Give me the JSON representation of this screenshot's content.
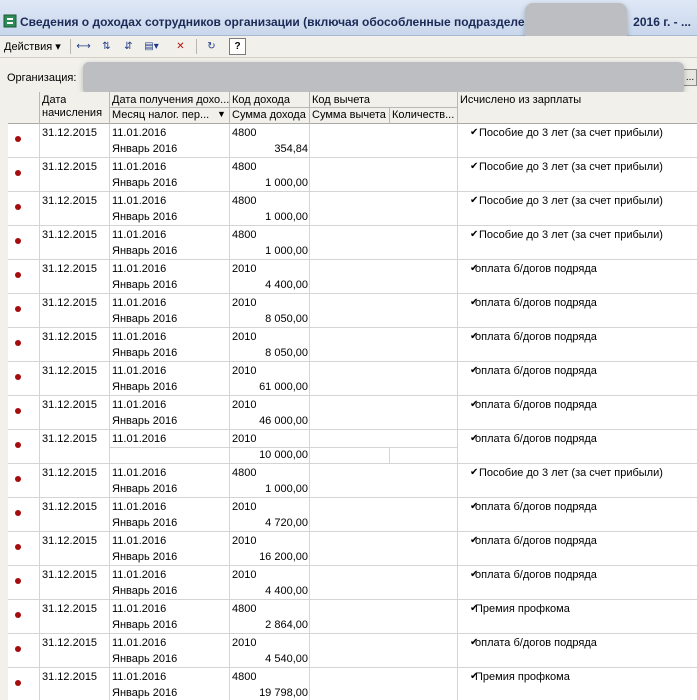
{
  "window": {
    "title": "Сведения о доходах сотрудников организации (включая обособленные подразделен",
    "title_suffix": "2016 г. - ..."
  },
  "toolbar": {
    "actions_label": "Действия ▾",
    "help_label": "?"
  },
  "organization": {
    "label": "Организация:",
    "button_label": "..."
  },
  "table": {
    "headers": {
      "date_accrual": "Дата",
      "date_accrual_2": "начисления",
      "date_income": "Дата получения дохо...",
      "tax_month": "Месяц налог. пер...",
      "income_code": "Код дохода",
      "income_sum": "Сумма дохода",
      "deduction_code": "Код вычета",
      "deduction_sum": "Сумма вычета",
      "quantity": "Количеств...",
      "calculated_from": "Исчислено из зарплаты"
    },
    "rows": [
      {
        "date": "31.12.2015",
        "received": "11.01.2016",
        "month": "Январь 2016",
        "code": "4800",
        "amount": "354,84",
        "source": "Пособие до 3 лет (за счет прибыли)"
      },
      {
        "date": "31.12.2015",
        "received": "11.01.2016",
        "month": "Январь 2016",
        "code": "4800",
        "amount": "1 000,00",
        "source": "Пособие до 3 лет (за счет прибыли)"
      },
      {
        "date": "31.12.2015",
        "received": "11.01.2016",
        "month": "Январь 2016",
        "code": "4800",
        "amount": "1 000,00",
        "source": "Пособие до 3 лет (за счет прибыли)"
      },
      {
        "date": "31.12.2015",
        "received": "11.01.2016",
        "month": "Январь 2016",
        "code": "4800",
        "amount": "1 000,00",
        "source": "Пособие до 3 лет (за счет прибыли)"
      },
      {
        "date": "31.12.2015",
        "received": "11.01.2016",
        "month": "Январь 2016",
        "code": "2010",
        "amount": "4 400,00",
        "source": "оплата б/догов подряда"
      },
      {
        "date": "31.12.2015",
        "received": "11.01.2016",
        "month": "Январь 2016",
        "code": "2010",
        "amount": "8 050,00",
        "source": "оплата б/догов подряда"
      },
      {
        "date": "31.12.2015",
        "received": "11.01.2016",
        "month": "Январь 2016",
        "code": "2010",
        "amount": "8 050,00",
        "source": "оплата б/догов подряда"
      },
      {
        "date": "31.12.2015",
        "received": "11.01.2016",
        "month": "Январь 2016",
        "code": "2010",
        "amount": "61 000,00",
        "source": "оплата б/догов подряда"
      },
      {
        "date": "31.12.2015",
        "received": "11.01.2016",
        "month": "Январь 2016",
        "code": "2010",
        "amount": "46 000,00",
        "source": "оплата б/догов подряда"
      },
      {
        "date": "31.12.2015",
        "received": "11.01.2016",
        "month": "",
        "code": "2010",
        "amount": "10 000,00",
        "source": "оплата б/догов подряда"
      },
      {
        "date": "31.12.2015",
        "received": "11.01.2016",
        "month": "Январь 2016",
        "code": "4800",
        "amount": "1 000,00",
        "source": "Пособие до 3 лет (за счет прибыли)"
      },
      {
        "date": "31.12.2015",
        "received": "11.01.2016",
        "month": "Январь 2016",
        "code": "2010",
        "amount": "4 720,00",
        "source": "оплата б/догов подряда"
      },
      {
        "date": "31.12.2015",
        "received": "11.01.2016",
        "month": "Январь 2016",
        "code": "2010",
        "amount": "16 200,00",
        "source": "оплата б/догов подряда"
      },
      {
        "date": "31.12.2015",
        "received": "11.01.2016",
        "month": "Январь 2016",
        "code": "2010",
        "amount": "4 400,00",
        "source": "оплата б/догов подряда"
      },
      {
        "date": "31.12.2015",
        "received": "11.01.2016",
        "month": "Январь 2016",
        "code": "4800",
        "amount": "2 864,00",
        "source": "Премия профкома"
      },
      {
        "date": "31.12.2015",
        "received": "11.01.2016",
        "month": "Январь 2016",
        "code": "2010",
        "amount": "4 540,00",
        "source": "оплата б/догов подряда"
      },
      {
        "date": "31.12.2015",
        "received": "11.01.2016",
        "month": "Январь 2016",
        "code": "4800",
        "amount": "19 798,00",
        "source": "Премия профкома"
      }
    ]
  },
  "colors": {
    "marker": "#a50c0c",
    "title_text": "#1b2a56"
  }
}
